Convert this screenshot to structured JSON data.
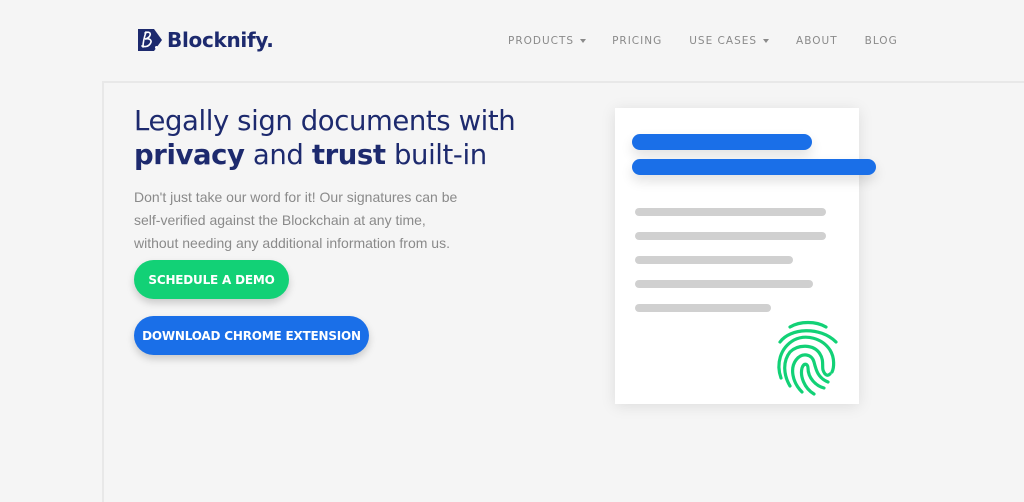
{
  "brand": {
    "name": "Blocknify.",
    "logo_icon": "blocknify-b-logo-icon",
    "primary_color": "#1d2a6e",
    "accent_green": "#12d176",
    "accent_blue": "#1a6fe8"
  },
  "nav": {
    "items": [
      {
        "label": "PRODUCTS",
        "has_dropdown": true,
        "icon": "caret-down-icon"
      },
      {
        "label": "PRICING",
        "has_dropdown": false
      },
      {
        "label": "USE CASES",
        "has_dropdown": true,
        "icon": "caret-down-icon"
      },
      {
        "label": "ABOUT",
        "has_dropdown": false
      },
      {
        "label": "BLOG",
        "has_dropdown": false
      }
    ]
  },
  "hero": {
    "title_line1": "Legally sign documents with",
    "title_bold1": "privacy",
    "title_mid": " and ",
    "title_bold2": "trust",
    "title_end": " built-in",
    "description": "Don't just take our word for it! Our signatures can be self-verified against the Blockchain at any time, without needing any additional information from us.",
    "buttons": {
      "demo_label": "SCHEDULE A DEMO",
      "chrome_label": "DOWNLOAD CHROME EXTENSION"
    }
  },
  "illustration": {
    "type": "document-with-fingerprint",
    "icon": "fingerprint-icon"
  }
}
